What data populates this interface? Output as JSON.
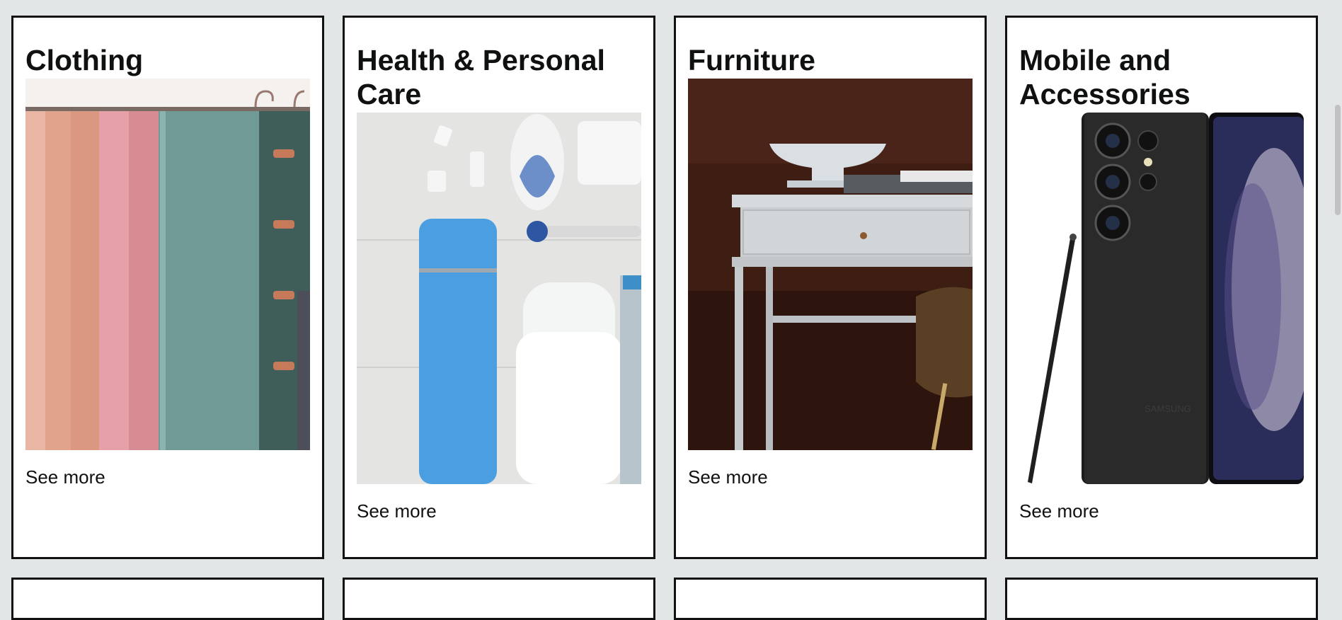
{
  "cards": [
    {
      "title": "Clothing",
      "image": "clothing-scarves-image",
      "link": "See more"
    },
    {
      "title": "Health & Personal Care",
      "image": "personal-care-products-image",
      "link": "See more"
    },
    {
      "title": "Furniture",
      "image": "white-desk-image",
      "link": "See more"
    },
    {
      "title": "Mobile and Accessories",
      "image": "samsung-phone-image",
      "link": "See more"
    }
  ],
  "phone_brand": "SAMSUNG"
}
